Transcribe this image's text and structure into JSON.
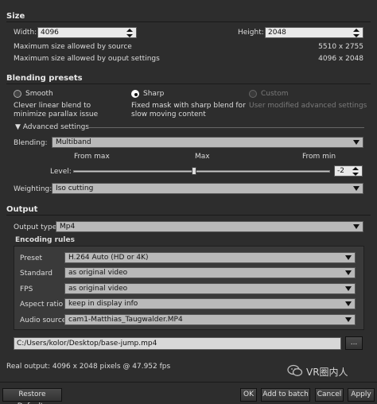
{
  "size": {
    "title": "Size",
    "width_label": "Width:",
    "width_value": "4096",
    "height_label": "Height:",
    "height_value": "2048",
    "max_source_label": "Maximum size allowed by source",
    "max_source_value": "5510 x 2755",
    "max_output_label": "Maximum size allowed by ouput settings",
    "max_output_value": "4096 x 2048"
  },
  "blending": {
    "title": "Blending presets",
    "options": [
      {
        "label": "Smooth",
        "desc": "Clever linear blend to minimize parallax issue",
        "selected": false,
        "enabled": true
      },
      {
        "label": "Sharp",
        "desc": "Fixed mask with sharp blend for slow moving content",
        "selected": true,
        "enabled": true
      },
      {
        "label": "Custom",
        "desc": "User modified advanced settings",
        "selected": false,
        "enabled": false
      }
    ],
    "advanced_label": "Advanced settings",
    "blending_label": "Blending:",
    "blending_value": "Multiband",
    "level_from_max": "From max",
    "level_max": "Max",
    "level_from_min": "From min",
    "level_label": "Level:",
    "level_value": "-2",
    "level_slider_fraction": 0.47,
    "weighting_label": "Weighting:",
    "weighting_value": "Iso cutting"
  },
  "output": {
    "title": "Output",
    "type_label": "Output type",
    "type_value": "Mp4",
    "encoding_title": "Encoding rules",
    "rules": [
      {
        "label": "Preset",
        "value": "H.264 Auto (HD or 4K)"
      },
      {
        "label": "Standard",
        "value": "as original video"
      },
      {
        "label": "FPS",
        "value": "as original video"
      },
      {
        "label": "Aspect ratio",
        "value": "keep in display info"
      },
      {
        "label": "Audio source",
        "value": "cam1-Matthias_Taugwalder.MP4"
      }
    ],
    "path_value": "C:/Users/kolor/Desktop/base-jump.mp4",
    "browse_label": "...",
    "real_output": "Real output: 4096 x 2048 pixels @ 47.952 fps"
  },
  "watermark": "VR圈内人",
  "footer": {
    "restore": "Restore Defaults",
    "ok": "OK",
    "add_batch": "Add to batch",
    "cancel": "Cancel",
    "apply": "Apply"
  }
}
